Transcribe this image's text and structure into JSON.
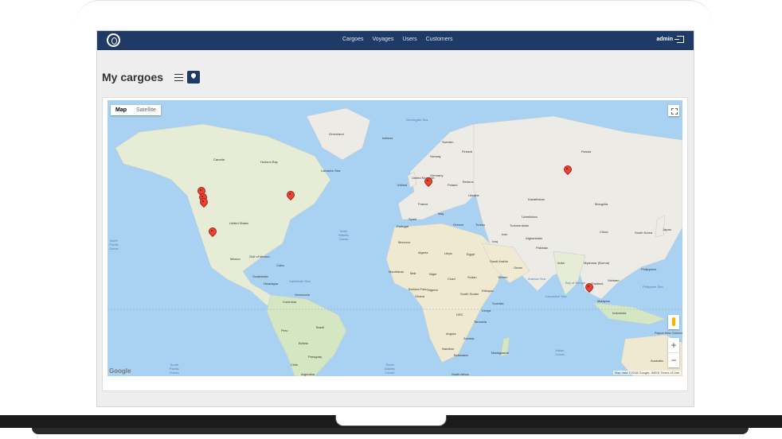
{
  "nav": {
    "links": [
      "Cargoes",
      "Voyages",
      "Users",
      "Customers"
    ],
    "user": "admin"
  },
  "page": {
    "title": "My cargoes"
  },
  "map": {
    "type_buttons": [
      "Map",
      "Satellite"
    ],
    "active_type": "Map",
    "zoom_in": "+",
    "zoom_out": "−",
    "attribution": "Map data ©2018 Google, INEGI   Terms of Use",
    "google_logo": "Google",
    "country_labels": [
      "Greenland",
      "Iceland",
      "Sweden",
      "Finland",
      "Norway",
      "Russia",
      "Canada",
      "Hudson Bay",
      "Labrador Sea",
      "United Kingdom",
      "Ireland",
      "Germany",
      "Poland",
      "Belarus",
      "Ukraine",
      "France",
      "Italy",
      "Spain",
      "Portugal",
      "Greece",
      "Turkey",
      "Kazakhstan",
      "Mongolia",
      "Uzbekistan",
      "Turkmenistan",
      "China",
      "South Korea",
      "Japan",
      "Afghanistan",
      "Pakistan",
      "Iran",
      "Iraq",
      "India",
      "Myanmar (Burma)",
      "Thailand",
      "Vietnam",
      "Philippines",
      "Malaysia",
      "Indonesia",
      "United States",
      "Mexico",
      "Cuba",
      "Guatemala",
      "Nicaragua",
      "Venezuela",
      "Colombia",
      "Peru",
      "Brazil",
      "Bolivia",
      "Chile",
      "Paraguay",
      "Argentina",
      "Morocco",
      "Algeria",
      "Libya",
      "Egypt",
      "Saudi Arabia",
      "Mauritania",
      "Mali",
      "Niger",
      "Chad",
      "Sudan",
      "Yemen",
      "Nigeria",
      "Ethiopia",
      "Somalia",
      "South Sudan",
      "Kenya",
      "DRC",
      "Tanzania",
      "Angola",
      "Zambia",
      "Namibia",
      "Botswana",
      "Madagascar",
      "South Africa",
      "Australia",
      "Papua New Guinea",
      "Oman",
      "Burkina Faso",
      "Ghana",
      "Gulf of Mexico"
    ],
    "ocean_labels": [
      "North\nPacific\nOcean",
      "North\nAtlantic\nOcean",
      "South\nPacific\nOcean",
      "South\nAtlantic\nOcean",
      "Indian\nOcean",
      "Arabian Sea",
      "Bay of Bengal",
      "Caribbean Sea",
      "Norwegian Sea",
      "Philippine Sea",
      "Laccadive Sea"
    ],
    "marker_count": 9
  }
}
